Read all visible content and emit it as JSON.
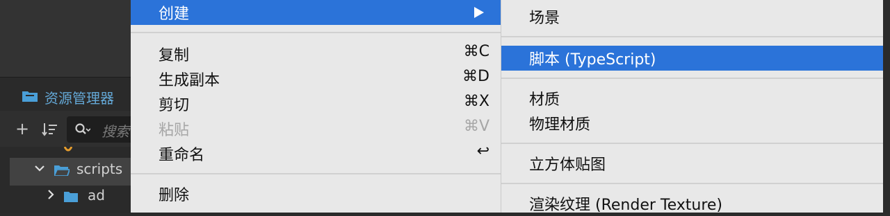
{
  "assets_panel": {
    "title": "资源管理器",
    "search_placeholder": "搜索",
    "tree": [
      {
        "label": "scripts",
        "expanded": true,
        "selected": true
      },
      {
        "label": "ad",
        "expanded": false
      }
    ]
  },
  "context_menu": {
    "items": [
      {
        "label": "创建",
        "shortcut": "",
        "highlighted": true,
        "has_submenu": true
      },
      {
        "label": "复制",
        "shortcut": "⌘C"
      },
      {
        "label": "生成副本",
        "shortcut": "⌘D"
      },
      {
        "label": "剪切",
        "shortcut": "⌘X"
      },
      {
        "label": "粘贴",
        "shortcut": "⌘V",
        "disabled": true
      },
      {
        "label": "重命名",
        "shortcut": "↩"
      },
      {
        "label": "删除",
        "shortcut": ""
      }
    ]
  },
  "submenu": {
    "items": [
      {
        "label": "场景"
      },
      {
        "label": "脚本 (TypeScript)",
        "highlighted": true
      },
      {
        "label": "材质"
      },
      {
        "label": "物理材质"
      },
      {
        "label": "立方体贴图"
      },
      {
        "label": "渲染纹理 (Render Texture)"
      }
    ]
  },
  "colors": {
    "highlight": "#2b73d9",
    "menu_bg": "#e8e8e8",
    "panel_title": "#64a8d6",
    "folder_blue": "#4a9fd8"
  }
}
